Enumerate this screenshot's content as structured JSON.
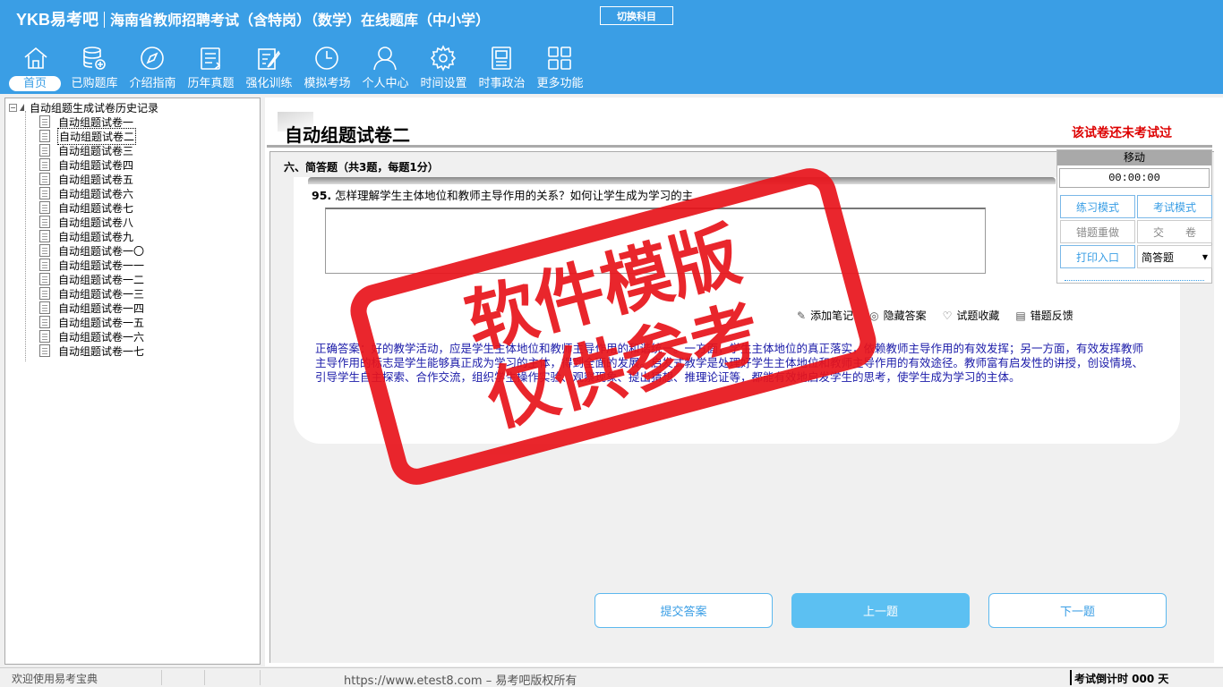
{
  "header": {
    "logo": "YKB易考吧",
    "title": "海南省教师招聘考试（含特岗）（数学）在线题库（中小学）",
    "switch_subject": "切换科目"
  },
  "nav": [
    {
      "label": "首页",
      "icon": "home-icon"
    },
    {
      "label": "已购题库",
      "icon": "database-icon"
    },
    {
      "label": "介绍指南",
      "icon": "compass-icon"
    },
    {
      "label": "历年真题",
      "icon": "list-icon"
    },
    {
      "label": "强化训练",
      "icon": "edit-icon"
    },
    {
      "label": "模拟考场",
      "icon": "clock-icon"
    },
    {
      "label": "个人中心",
      "icon": "user-icon"
    },
    {
      "label": "时间设置",
      "icon": "gear-icon"
    },
    {
      "label": "时事政治",
      "icon": "book-icon"
    },
    {
      "label": "更多功能",
      "icon": "grid-icon"
    }
  ],
  "tree": {
    "root": "自动组题生成试卷历史记录",
    "items": [
      "自动组题试卷一",
      "自动组题试卷二",
      "自动组题试卷三",
      "自动组题试卷四",
      "自动组题试卷五",
      "自动组题试卷六",
      "自动组题试卷七",
      "自动组题试卷八",
      "自动组题试卷九",
      "自动组题试卷一〇",
      "自动组题试卷一一",
      "自动组题试卷一二",
      "自动组题试卷一三",
      "自动组题试卷一四",
      "自动组题试卷一五",
      "自动组题试卷一六",
      "自动组题试卷一七"
    ],
    "selected_index": 1
  },
  "main": {
    "paper_title": "自动组题试卷二",
    "status": "该试卷还未考试过",
    "section_title": "六、简答题（共3题，每题1分）",
    "question_number": "95.",
    "question_text": "怎样理解学生主体地位和教师主导作用的关系？如何让学生成为学习的主",
    "tools": {
      "add_note": "添加笔记",
      "hide_answer": "隐藏答案",
      "favorite": "试题收藏",
      "report_error": "错题反馈"
    },
    "correct_answer": "正确答案：好的教学活动，应是学生主体地位和教师主导作用的和谐统一。一方面，学生主体地位的真正落实，依赖教师主导作用的有效发挥；另一方面，有效发挥教师主导作用的标志是学生能够真正成为学习的主体，得到全面的发展。启发式教学是处理好学生主体地位和教师主导作用的有效途径。教师富有启发性的讲授，创设情境、引导学生自主探索、合作交流，组织学生操作实验、观察现象、提出猜想、推理论证等，都能有效地启发学生的思考，使学生成为学习的主体。",
    "buttons": {
      "submit": "提交答案",
      "prev": "上一题",
      "next": "下一题"
    }
  },
  "panel": {
    "header": "移动",
    "timer": "00:00:00",
    "practice_mode": "练习模式",
    "exam_mode": "考试模式",
    "redo_wrong": "错题重做",
    "submit_paper": "交　　卷",
    "print": "打印入口",
    "question_type": "简答题"
  },
  "watermark": {
    "line1": "软件模版",
    "line2": "仅供参考"
  },
  "statusbar": {
    "welcome": "欢迎使用易考宝典",
    "copyright": "https://www.etest8.com – 易考吧版权所有",
    "countdown": "考试倒计时 000 天"
  },
  "colors": {
    "brand": "#3a9ee5",
    "status_red": "#dd0000",
    "answer_blue": "#1a1aa8",
    "watermark": "#e8141b"
  }
}
